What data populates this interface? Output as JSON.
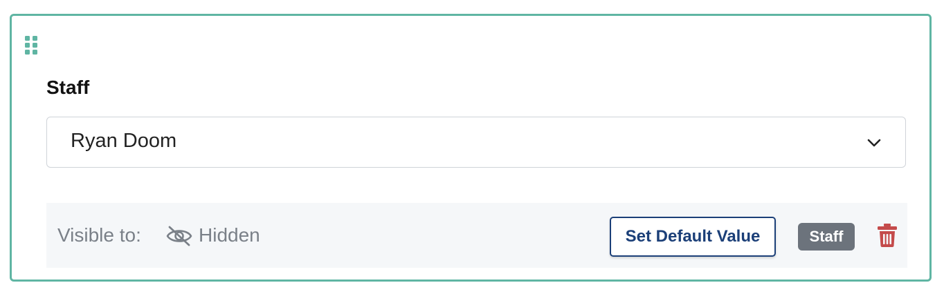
{
  "field": {
    "label": "Staff",
    "selected_value": "Ryan Doom"
  },
  "footer": {
    "visible_to_label": "Visible to:",
    "visibility_value": "Hidden",
    "default_button_label": "Set Default Value",
    "badge_label": "Staff"
  },
  "colors": {
    "card_border": "#5fb5a3",
    "accent_navy": "#1b3f78",
    "badge_bg": "#6c737c",
    "delete_red": "#c44b4b"
  },
  "icons": {
    "drag": "drag-handle-icon",
    "chevron": "chevron-down-icon",
    "visibility": "eye-slash-icon",
    "delete": "trash-icon"
  }
}
